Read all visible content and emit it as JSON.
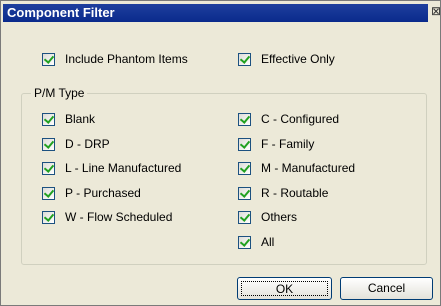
{
  "window": {
    "title": "Component Filter",
    "close_glyph": "⊠"
  },
  "options": {
    "include_phantom": {
      "label": "Include Phantom Items",
      "checked": true
    },
    "effective_only": {
      "label": "Effective Only",
      "checked": true
    }
  },
  "pm_type": {
    "legend": "P/M Type",
    "left": [
      {
        "label": "Blank",
        "checked": true
      },
      {
        "label": "D - DRP",
        "checked": true
      },
      {
        "label": "L - Line Manufactured",
        "checked": true
      },
      {
        "label": "P - Purchased",
        "checked": true
      },
      {
        "label": "W - Flow Scheduled",
        "checked": true
      }
    ],
    "right": [
      {
        "label": "C - Configured",
        "checked": true
      },
      {
        "label": "F - Family",
        "checked": true
      },
      {
        "label": "M - Manufactured",
        "checked": true
      },
      {
        "label": "R - Routable",
        "checked": true
      },
      {
        "label": "Others",
        "checked": true
      },
      {
        "label": "All",
        "checked": true
      }
    ]
  },
  "buttons": {
    "ok": "OK",
    "cancel": "Cancel"
  },
  "colors": {
    "titlebar": "#0a2a8c",
    "check": "#21a121",
    "dialog_bg": "#ece9d8"
  }
}
